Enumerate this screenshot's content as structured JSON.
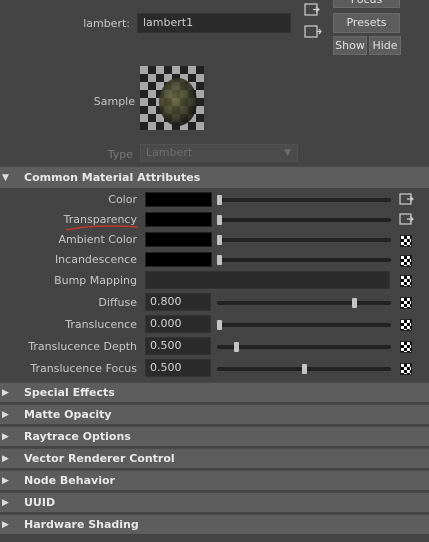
{
  "header": {
    "node_type_label": "lambert:",
    "node_name": "lambert1",
    "focus_label": "Focus",
    "presets_label": "Presets",
    "show_label": "Show",
    "hide_label": "Hide"
  },
  "sample": {
    "label": "Sample"
  },
  "type_row": {
    "label": "Type",
    "value": "Lambert"
  },
  "common_section": {
    "title": "Common Material Attributes",
    "color_rows": [
      {
        "label": "Color",
        "slider": 0.0,
        "icon": "connect-icon"
      },
      {
        "label": "Transparency",
        "slider": 0.0,
        "icon": "connect-icon"
      },
      {
        "label": "Ambient Color",
        "slider": 0.0,
        "icon": "checker-icon"
      },
      {
        "label": "Incandescence",
        "slider": 0.0,
        "icon": "checker-icon"
      }
    ],
    "bump_label": "Bump Mapping",
    "num_rows": [
      {
        "label": "Diffuse",
        "value": "0.800",
        "slider": 0.8
      },
      {
        "label": "Translucence",
        "value": "0.000",
        "slider": 0.0
      },
      {
        "label": "Translucence Depth",
        "value": "0.500",
        "slider": 0.1
      },
      {
        "label": "Translucence Focus",
        "value": "0.500",
        "slider": 0.5
      }
    ]
  },
  "collapsed_sections": [
    "Special Effects",
    "Matte Opacity",
    "Raytrace Options",
    "Vector Renderer Control",
    "Node Behavior",
    "UUID",
    "Hardware Shading"
  ],
  "colors": {
    "panel_bg": "#444444",
    "header_bg": "#5d5d5d",
    "field_bg": "#2b2b2b",
    "annotation_underline": "#c0392b"
  }
}
